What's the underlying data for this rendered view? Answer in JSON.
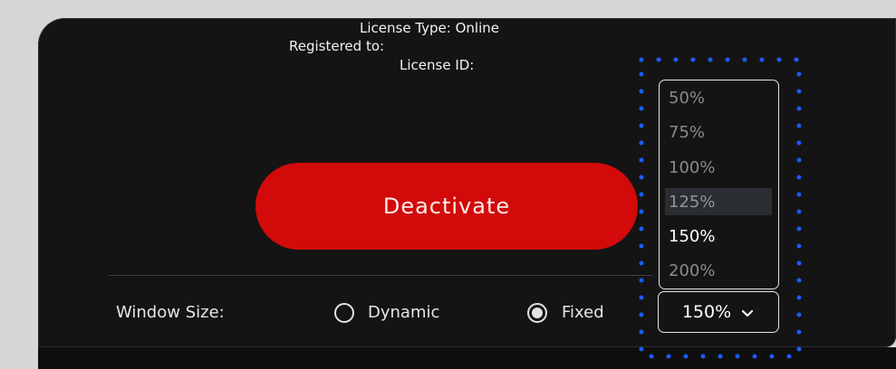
{
  "license": {
    "type_line": "License Type: Online",
    "registered_line": "Registered to:",
    "id_line": "License ID:"
  },
  "deactivate_label": "Deactivate",
  "window_size": {
    "label": "Window Size:",
    "options": [
      {
        "label": "Dynamic",
        "checked": false
      },
      {
        "label": "Fixed",
        "checked": true
      }
    ]
  },
  "zoom": {
    "selected": "150%",
    "options": [
      "50%",
      "75%",
      "100%",
      "125%",
      "150%",
      "200%"
    ],
    "hovered": "125%"
  },
  "colors": {
    "accent_red": "#d20a0a",
    "focus_blue": "#1a5cff",
    "panel": "#141414"
  },
  "icons": {
    "dropdown_toggle": "chevron-down-icon"
  }
}
